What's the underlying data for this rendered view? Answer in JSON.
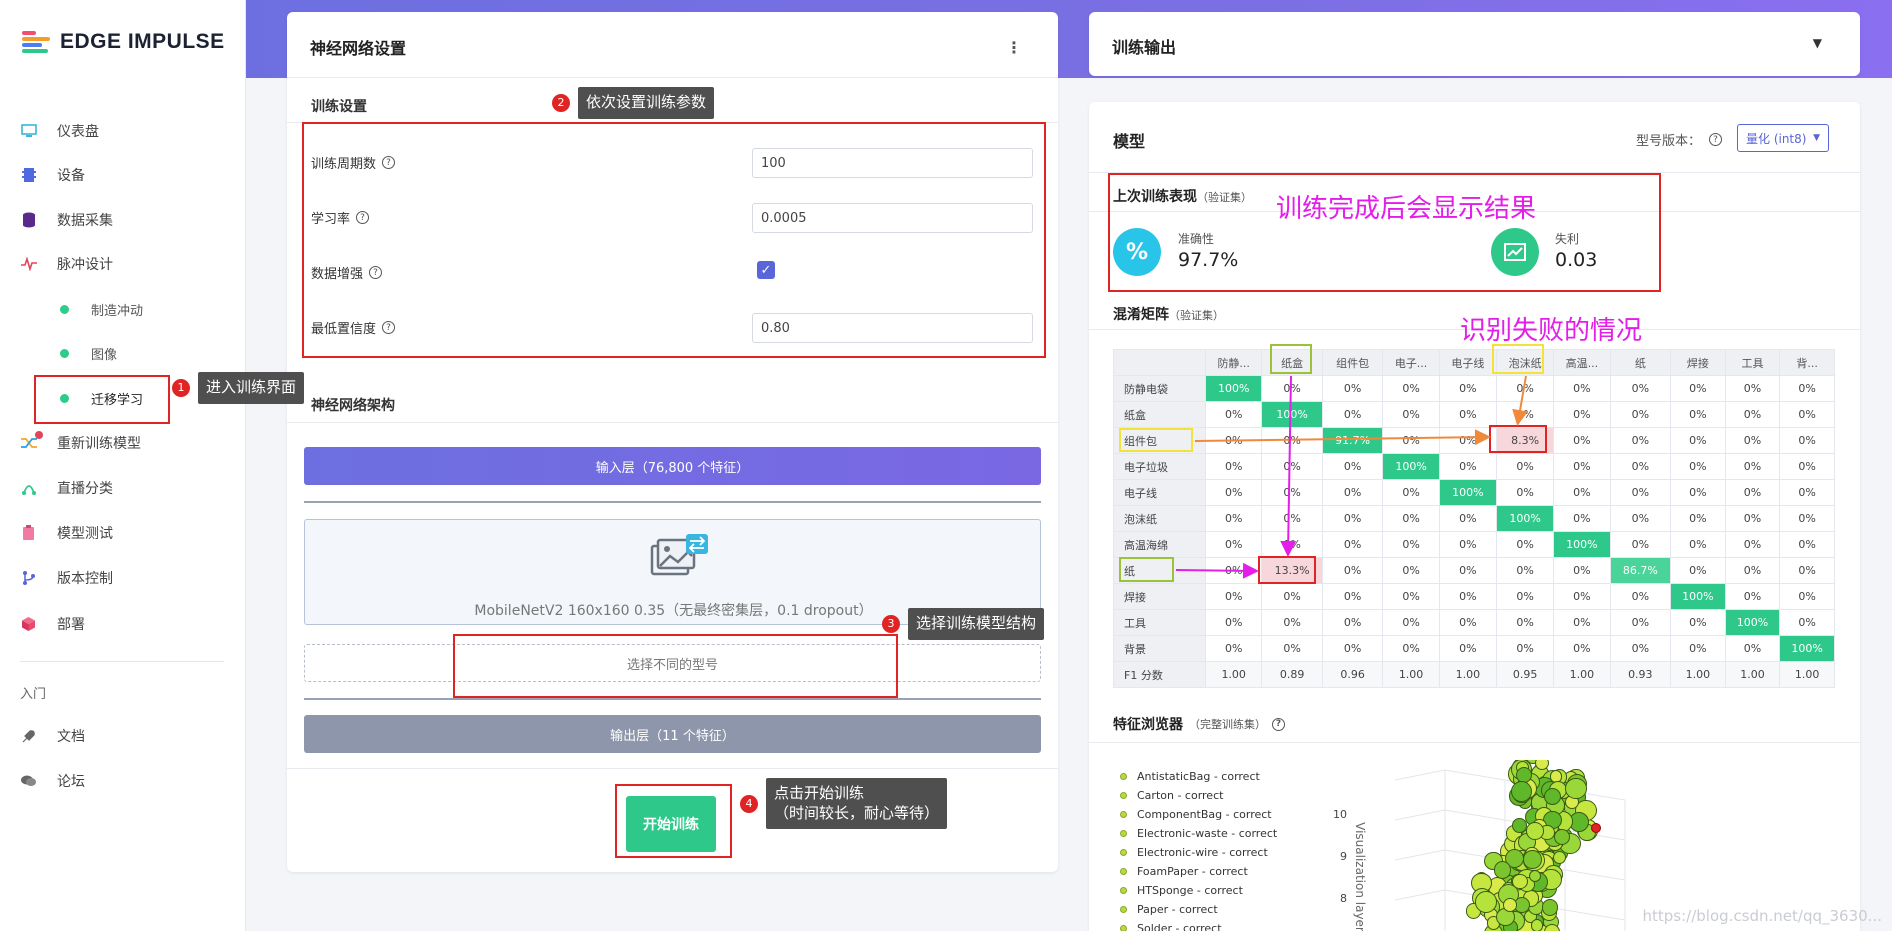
{
  "app": {
    "name": "EDGE IMPULSE"
  },
  "sidebar": {
    "items": [
      {
        "label": "仪表盘",
        "icon": "monitor-icon"
      },
      {
        "label": "设备",
        "icon": "chip-icon"
      },
      {
        "label": "数据采集",
        "icon": "database-icon"
      },
      {
        "label": "脉冲设计",
        "icon": "pulse-icon"
      },
      {
        "label": "重新训练模型",
        "icon": "shuffle-icon"
      },
      {
        "label": "直播分类",
        "icon": "live-icon"
      },
      {
        "label": "模型测试",
        "icon": "clipboard-icon"
      },
      {
        "label": "版本控制",
        "icon": "branch-icon"
      },
      {
        "label": "部署",
        "icon": "cube-icon"
      }
    ],
    "subitems": [
      "制造冲动",
      "图像",
      "迁移学习"
    ],
    "section": "入门",
    "help": [
      {
        "label": "文档",
        "icon": "rocket-icon"
      },
      {
        "label": "论坛",
        "icon": "chat-icon"
      }
    ]
  },
  "nn": {
    "title": "神经网络设置",
    "training_title": "训练设置",
    "fields": [
      {
        "label": "训练周期数",
        "value": "100"
      },
      {
        "label": "学习率",
        "value": "0.0005"
      },
      {
        "label": "数据增强",
        "checked": true
      },
      {
        "label": "最低置信度",
        "value": "0.80"
      }
    ],
    "arch_title": "神经网络架构",
    "input_layer": "输入层（76,800 个特征）",
    "model_desc": "MobileNetV2 160x160 0.35（无最终密集层，0.1 dropout）",
    "choose_model": "选择不同的型号",
    "output_layer": "输出层（11 个特征）",
    "start_button": "开始训练"
  },
  "annotations": {
    "a1": {
      "num": "1",
      "text": "进入训练界面"
    },
    "a2": {
      "num": "2",
      "text": "依次设置训练参数"
    },
    "a3": {
      "num": "3",
      "text": "选择训练模型结构"
    },
    "a4": {
      "num": "4",
      "line1": "点击开始训练",
      "line2": "（时间较长，耐心等待）"
    },
    "result": "训练完成后会显示结果",
    "failure": "识别失败的情况"
  },
  "output": {
    "title": "训练输出",
    "model_title": "模型",
    "version_label": "型号版本：",
    "version_value": "量化 (int8)",
    "last_perf": "上次训练表现",
    "val_set": "（验证集）",
    "accuracy_label": "准确性",
    "accuracy_value": "97.7%",
    "loss_label": "失利",
    "loss_value": "0.03",
    "cm_title": "混淆矩阵",
    "cm_cols": [
      "防静...",
      "纸盒",
      "组件包",
      "电子...",
      "电子线",
      "泡沫纸",
      "高温...",
      "纸",
      "焊接",
      "工具",
      "背..."
    ],
    "cm_rows": [
      {
        "label": "防静电袋",
        "cells": [
          "100%",
          "0%",
          "0%",
          "0%",
          "0%",
          "0%",
          "0%",
          "0%",
          "0%",
          "0%",
          "0%"
        ]
      },
      {
        "label": "纸盒",
        "cells": [
          "0%",
          "100%",
          "0%",
          "0%",
          "0%",
          "0%",
          "0%",
          "0%",
          "0%",
          "0%",
          "0%"
        ]
      },
      {
        "label": "组件包",
        "cells": [
          "0%",
          "0%",
          "91.7%",
          "0%",
          "0%",
          "8.3%",
          "0%",
          "0%",
          "0%",
          "0%",
          "0%"
        ]
      },
      {
        "label": "电子垃圾",
        "cells": [
          "0%",
          "0%",
          "0%",
          "100%",
          "0%",
          "0%",
          "0%",
          "0%",
          "0%",
          "0%",
          "0%"
        ]
      },
      {
        "label": "电子线",
        "cells": [
          "0%",
          "0%",
          "0%",
          "0%",
          "100%",
          "0%",
          "0%",
          "0%",
          "0%",
          "0%",
          "0%"
        ]
      },
      {
        "label": "泡沫纸",
        "cells": [
          "0%",
          "0%",
          "0%",
          "0%",
          "0%",
          "100%",
          "0%",
          "0%",
          "0%",
          "0%",
          "0%"
        ]
      },
      {
        "label": "高温海绵",
        "cells": [
          "0%",
          "0%",
          "0%",
          "0%",
          "0%",
          "0%",
          "100%",
          "0%",
          "0%",
          "0%",
          "0%"
        ]
      },
      {
        "label": "纸",
        "cells": [
          "0%",
          "13.3%",
          "0%",
          "0%",
          "0%",
          "0%",
          "0%",
          "86.7%",
          "0%",
          "0%",
          "0%"
        ]
      },
      {
        "label": "焊接",
        "cells": [
          "0%",
          "0%",
          "0%",
          "0%",
          "0%",
          "0%",
          "0%",
          "0%",
          "100%",
          "0%",
          "0%"
        ]
      },
      {
        "label": "工具",
        "cells": [
          "0%",
          "0%",
          "0%",
          "0%",
          "0%",
          "0%",
          "0%",
          "0%",
          "0%",
          "100%",
          "0%"
        ]
      },
      {
        "label": "背景",
        "cells": [
          "0%",
          "0%",
          "0%",
          "0%",
          "0%",
          "0%",
          "0%",
          "0%",
          "0%",
          "0%",
          "100%"
        ]
      }
    ],
    "f1_label": "F1 分数",
    "f1_values": [
      "1.00",
      "0.89",
      "0.96",
      "1.00",
      "1.00",
      "0.95",
      "1.00",
      "0.93",
      "1.00",
      "1.00",
      "1.00"
    ],
    "fe_title": "特征浏览器",
    "fe_subtitle": "（完整训练集）",
    "legend": [
      "AntistaticBag - correct",
      "Carton - correct",
      "ComponentBag - correct",
      "Electronic-waste - correct",
      "Electronic-wire - correct",
      "FoamPaper - correct",
      "HTSponge - correct",
      "Paper - correct",
      "Solder - correct"
    ],
    "axis_label": "Visualization layer",
    "ticks": [
      "10",
      "9",
      "8"
    ]
  },
  "watermark": "https://blog.csdn.net/qq_3630..."
}
